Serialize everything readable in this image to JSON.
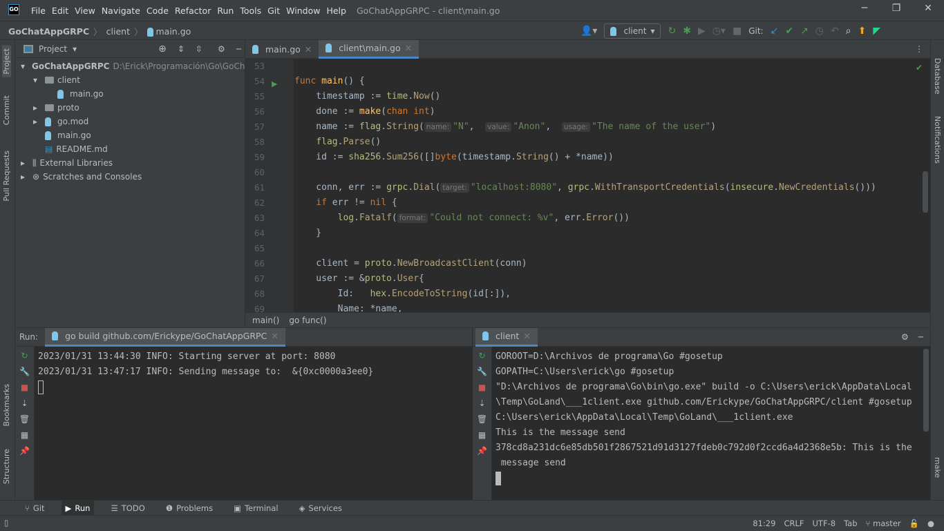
{
  "app": {
    "logo": "GO",
    "title": "GoChatAppGRPC - client\\main.go"
  },
  "menu": [
    "File",
    "Edit",
    "View",
    "Navigate",
    "Code",
    "Refactor",
    "Run",
    "Tools",
    "Git",
    "Window",
    "Help"
  ],
  "nav": {
    "crumbs": [
      "GoChatAppGRPC",
      "client",
      "main.go"
    ],
    "run_config": "client",
    "git_label": "Git:"
  },
  "left_stripe": [
    "Project",
    "Commit",
    "Pull Requests",
    "Bookmarks",
    "Structure"
  ],
  "right_stripe": [
    "Database",
    "Notifications",
    "make"
  ],
  "project": {
    "title": "Project",
    "tree": [
      {
        "label": "GoChatAppGRPC",
        "path": "D:\\Erick\\Programación\\Go\\GoChatA",
        "icon": "folder",
        "depth": 0,
        "arrow": "▾"
      },
      {
        "label": "client",
        "icon": "folder",
        "depth": 1,
        "arrow": "▾"
      },
      {
        "label": "main.go",
        "icon": "go-file",
        "depth": 2,
        "arrow": ""
      },
      {
        "label": "proto",
        "icon": "folder",
        "depth": 1,
        "arrow": "▸"
      },
      {
        "label": "go.mod",
        "icon": "go-file",
        "depth": 1,
        "arrow": "▸"
      },
      {
        "label": "main.go",
        "icon": "go-file",
        "depth": 1,
        "arrow": ""
      },
      {
        "label": "README.md",
        "icon": "md-file",
        "depth": 1,
        "arrow": ""
      },
      {
        "label": "External Libraries",
        "icon": "library",
        "depth": 0,
        "arrow": "▸"
      },
      {
        "label": "Scratches and Consoles",
        "icon": "scratch",
        "depth": 0,
        "arrow": "▸"
      }
    ]
  },
  "editor": {
    "tabs": [
      {
        "label": "main.go",
        "active": false
      },
      {
        "label": "client\\main.go",
        "active": true
      }
    ],
    "lines": [
      {
        "n": "53",
        "tokens": []
      },
      {
        "n": "54",
        "tokens": [
          {
            "t": "func ",
            "c": "kw"
          },
          {
            "t": "main",
            "c": "fd"
          },
          {
            "t": "() {",
            "c": ""
          }
        ]
      },
      {
        "n": "55",
        "tokens": [
          {
            "t": "    timestamp := ",
            "c": ""
          },
          {
            "t": "time",
            "c": "pkg"
          },
          {
            "t": ".",
            "c": ""
          },
          {
            "t": "Now",
            "c": "call"
          },
          {
            "t": "()",
            "c": ""
          }
        ]
      },
      {
        "n": "56",
        "tokens": [
          {
            "t": "    done := ",
            "c": ""
          },
          {
            "t": "make",
            "c": "fd"
          },
          {
            "t": "(",
            "c": ""
          },
          {
            "t": "chan int",
            "c": "kw"
          },
          {
            "t": ")",
            "c": ""
          }
        ]
      },
      {
        "n": "57",
        "tokens": [
          {
            "t": "    name := ",
            "c": ""
          },
          {
            "t": "flag",
            "c": "pkg"
          },
          {
            "t": ".",
            "c": ""
          },
          {
            "t": "String",
            "c": "call"
          },
          {
            "t": "(",
            "c": ""
          },
          {
            "t": "name:",
            "c": "hint"
          },
          {
            "t": "\"N\"",
            "c": "str"
          },
          {
            "t": ",  ",
            "c": ""
          },
          {
            "t": "value:",
            "c": "hint"
          },
          {
            "t": "\"Anon\"",
            "c": "str"
          },
          {
            "t": ",  ",
            "c": ""
          },
          {
            "t": "usage:",
            "c": "hint"
          },
          {
            "t": "\"The name of the user\"",
            "c": "str"
          },
          {
            "t": ")",
            "c": ""
          }
        ]
      },
      {
        "n": "58",
        "tokens": [
          {
            "t": "    ",
            "c": ""
          },
          {
            "t": "flag",
            "c": "pkg"
          },
          {
            "t": ".",
            "c": ""
          },
          {
            "t": "Parse",
            "c": "call"
          },
          {
            "t": "()",
            "c": ""
          }
        ]
      },
      {
        "n": "59",
        "tokens": [
          {
            "t": "    id := ",
            "c": ""
          },
          {
            "t": "sha256",
            "c": "pkg"
          },
          {
            "t": ".",
            "c": ""
          },
          {
            "t": "Sum256",
            "c": "call"
          },
          {
            "t": "([]",
            "c": ""
          },
          {
            "t": "byte",
            "c": "kw"
          },
          {
            "t": "(timestamp.",
            "c": ""
          },
          {
            "t": "String",
            "c": "call"
          },
          {
            "t": "() + *name))",
            "c": ""
          }
        ]
      },
      {
        "n": "60",
        "tokens": []
      },
      {
        "n": "61",
        "tokens": [
          {
            "t": "    conn, err := ",
            "c": ""
          },
          {
            "t": "grpc",
            "c": "pkg"
          },
          {
            "t": ".",
            "c": ""
          },
          {
            "t": "Dial",
            "c": "call"
          },
          {
            "t": "(",
            "c": ""
          },
          {
            "t": "target:",
            "c": "hint"
          },
          {
            "t": "\"localhost:8080\"",
            "c": "str"
          },
          {
            "t": ", ",
            "c": ""
          },
          {
            "t": "grpc",
            "c": "pkg"
          },
          {
            "t": ".",
            "c": ""
          },
          {
            "t": "WithTransportCredentials",
            "c": "call"
          },
          {
            "t": "(",
            "c": ""
          },
          {
            "t": "insecure",
            "c": "pkg"
          },
          {
            "t": ".",
            "c": ""
          },
          {
            "t": "NewCredentials",
            "c": "call"
          },
          {
            "t": "()))",
            "c": ""
          }
        ]
      },
      {
        "n": "62",
        "tokens": [
          {
            "t": "    ",
            "c": ""
          },
          {
            "t": "if",
            "c": "kw"
          },
          {
            "t": " err != ",
            "c": ""
          },
          {
            "t": "nil",
            "c": "kw"
          },
          {
            "t": " {",
            "c": ""
          }
        ]
      },
      {
        "n": "63",
        "tokens": [
          {
            "t": "        ",
            "c": ""
          },
          {
            "t": "log",
            "c": "pkg"
          },
          {
            "t": ".",
            "c": ""
          },
          {
            "t": "Fatalf",
            "c": "call"
          },
          {
            "t": "(",
            "c": ""
          },
          {
            "t": "format:",
            "c": "hint"
          },
          {
            "t": "\"Could not connect: %v\"",
            "c": "str"
          },
          {
            "t": ", err.",
            "c": ""
          },
          {
            "t": "Error",
            "c": "call"
          },
          {
            "t": "())",
            "c": ""
          }
        ]
      },
      {
        "n": "64",
        "tokens": [
          {
            "t": "    }",
            "c": ""
          }
        ]
      },
      {
        "n": "65",
        "tokens": []
      },
      {
        "n": "66",
        "tokens": [
          {
            "t": "    client = ",
            "c": ""
          },
          {
            "t": "proto",
            "c": "pkg"
          },
          {
            "t": ".",
            "c": ""
          },
          {
            "t": "NewBroadcastClient",
            "c": "call"
          },
          {
            "t": "(conn)",
            "c": ""
          }
        ]
      },
      {
        "n": "67",
        "tokens": [
          {
            "t": "    user := &",
            "c": ""
          },
          {
            "t": "proto",
            "c": "pkg"
          },
          {
            "t": ".",
            "c": ""
          },
          {
            "t": "User",
            "c": "call"
          },
          {
            "t": "{",
            "c": ""
          }
        ]
      },
      {
        "n": "68",
        "tokens": [
          {
            "t": "        Id:   ",
            "c": ""
          },
          {
            "t": "hex",
            "c": "pkg"
          },
          {
            "t": ".",
            "c": ""
          },
          {
            "t": "EncodeToString",
            "c": "call"
          },
          {
            "t": "(id[:]),",
            "c": ""
          }
        ]
      },
      {
        "n": "69",
        "tokens": [
          {
            "t": "        Name: *name,",
            "c": ""
          }
        ]
      }
    ],
    "breadcrumb": [
      "main()",
      "go func()"
    ]
  },
  "run": {
    "label": "Run:",
    "left": {
      "tab": "go build github.com/Erickype/GoChatAppGRPC",
      "lines": [
        "2023/01/31 13:44:30 INFO: Starting server at port: 8080",
        "2023/01/31 13:47:17 INFO: Sending message to:  &{0xc0000a3ee0}"
      ]
    },
    "right": {
      "tab": "client",
      "lines": [
        "GOROOT=D:\\Archivos de programa\\Go #gosetup",
        "GOPATH=C:\\Users\\erick\\go #gosetup",
        "\"D:\\Archivos de programa\\Go\\bin\\go.exe\" build -o C:\\Users\\erick\\AppData\\Local",
        "\\Temp\\GoLand\\___1client.exe github.com/Erickype/GoChatAppGRPC/client #gosetup",
        "C:\\Users\\erick\\AppData\\Local\\Temp\\GoLand\\___1client.exe",
        "This is the message send",
        "378cd8a231dc6e85db501f2867521d91d3127fdeb0c792d0f2ccd6a4d2368e5b: This is the",
        " message send"
      ]
    }
  },
  "toolwindows": [
    {
      "label": "Git",
      "icon": "⑂"
    },
    {
      "label": "Run",
      "icon": "▶"
    },
    {
      "label": "TODO",
      "icon": "☰"
    },
    {
      "label": "Problems",
      "icon": "❶"
    },
    {
      "label": "Terminal",
      "icon": "▣"
    },
    {
      "label": "Services",
      "icon": "◈"
    }
  ],
  "status": {
    "position": "81:29",
    "line_sep": "CRLF",
    "encoding": "UTF-8",
    "indent": "Tab",
    "branch": "master"
  },
  "colors": {
    "accent": "#4a88c7",
    "run_green": "#499c54",
    "stop_red": "#c75450"
  }
}
